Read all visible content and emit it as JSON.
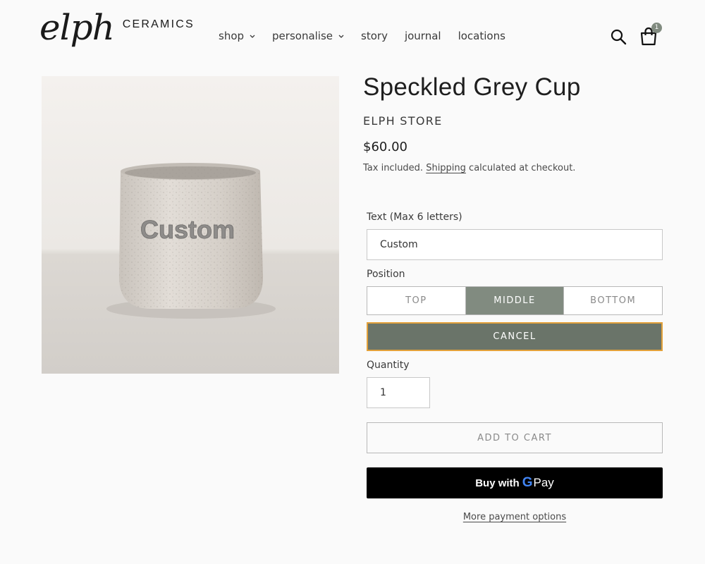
{
  "brand": {
    "script": "elph",
    "wordmark": "CERAMICS"
  },
  "nav": {
    "items": [
      {
        "label": "shop",
        "has_dropdown": true
      },
      {
        "label": "personalise",
        "has_dropdown": true
      },
      {
        "label": "story",
        "has_dropdown": false
      },
      {
        "label": "journal",
        "has_dropdown": false
      },
      {
        "label": "locations",
        "has_dropdown": false
      }
    ]
  },
  "header_icons": {
    "search": "search-icon",
    "cart": "shopping-bag-icon",
    "cart_count": "1"
  },
  "product": {
    "image_text": "Custom",
    "title": "Speckled Grey Cup",
    "vendor": "ELPH STORE",
    "price": "$60.00",
    "tax_prefix": "Tax included. ",
    "shipping_link": "Shipping",
    "tax_suffix": " calculated at checkout."
  },
  "options": {
    "text_label": "Text (Max 6 letters)",
    "text_value": "Custom",
    "position_label": "Position",
    "positions": [
      "TOP",
      "MIDDLE",
      "BOTTOM"
    ],
    "selected_position": "MIDDLE",
    "cancel_label": "CANCEL"
  },
  "quantity": {
    "label": "Quantity",
    "value": "1"
  },
  "actions": {
    "add_to_cart": "ADD TO CART",
    "gpay_prefix": "Buy with",
    "gpay_g": "G",
    "gpay_pay": "Pay",
    "more_payment": "More payment options"
  },
  "colors": {
    "accent_sage": "#818b80",
    "cancel_bg": "#6a7469",
    "focus_outline": "#e3a13a",
    "gpay_bg": "#000000"
  }
}
